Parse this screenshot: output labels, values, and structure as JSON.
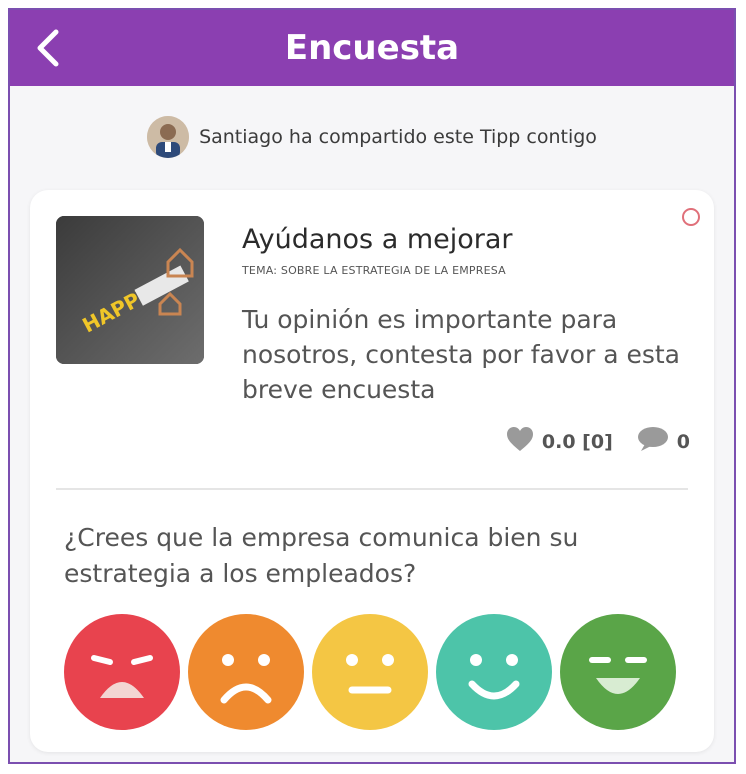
{
  "header": {
    "title": "Encuesta",
    "back_icon": "chevron-left-icon"
  },
  "share": {
    "text": "Santiago ha compartido este Tipp contigo"
  },
  "card": {
    "title": "Ayúdanos a mejorar",
    "topic": "TEMA: SOBRE LA ESTRATEGIA DE LA EMPRESA",
    "description": "Tu opinión es importante para nosotros, contesta por favor a esta breve encuesta",
    "rating": "0.0 [0]",
    "comments": "0",
    "question": "¿Crees que la empresa comunica bien su estrategia a los empleados?",
    "image_text": "HAPPY",
    "options": [
      {
        "name": "very-sad-face",
        "color": "#e8434e"
      },
      {
        "name": "sad-face",
        "color": "#ef8a2f"
      },
      {
        "name": "neutral-face",
        "color": "#f4c644"
      },
      {
        "name": "happy-face",
        "color": "#4dc4a9"
      },
      {
        "name": "very-happy-face",
        "color": "#5aa548"
      }
    ]
  },
  "colors": {
    "header": "#8b3fb1",
    "status_dot": "#e0707a"
  }
}
